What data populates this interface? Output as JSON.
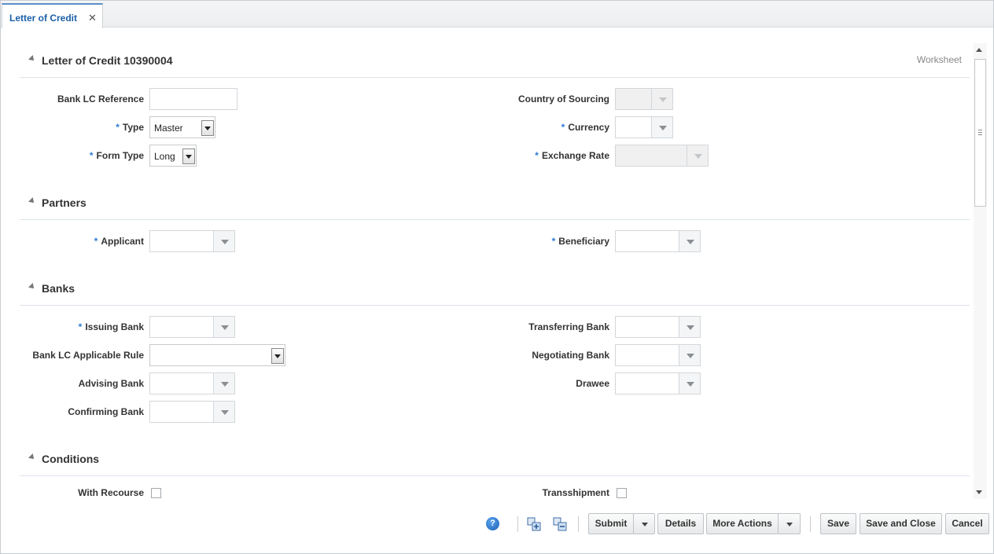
{
  "tab": {
    "label": "Letter of Credit",
    "close": "✕"
  },
  "header": {
    "title": "Letter of Credit 10390004",
    "status": "Worksheet"
  },
  "general": {
    "bank_lc_reference": {
      "label": "Bank LC Reference",
      "value": ""
    },
    "type": {
      "label": "Type",
      "value": "Master"
    },
    "form_type": {
      "label": "Form Type",
      "value": "Long"
    },
    "country_of_sourcing": {
      "label": "Country of Sourcing",
      "value": ""
    },
    "currency": {
      "label": "Currency",
      "value": ""
    },
    "exchange_rate": {
      "label": "Exchange Rate",
      "value": ""
    }
  },
  "partners": {
    "title": "Partners",
    "applicant": {
      "label": "Applicant",
      "value": ""
    },
    "beneficiary": {
      "label": "Beneficiary",
      "value": ""
    }
  },
  "banks": {
    "title": "Banks",
    "issuing_bank": {
      "label": "Issuing Bank",
      "value": ""
    },
    "bank_lc_applicable_rule": {
      "label": "Bank LC Applicable Rule",
      "value": ""
    },
    "advising_bank": {
      "label": "Advising Bank",
      "value": ""
    },
    "confirming_bank": {
      "label": "Confirming Bank",
      "value": ""
    },
    "transferring_bank": {
      "label": "Transferring Bank",
      "value": ""
    },
    "negotiating_bank": {
      "label": "Negotiating Bank",
      "value": ""
    },
    "drawee": {
      "label": "Drawee",
      "value": ""
    }
  },
  "conditions": {
    "title": "Conditions",
    "with_recourse": {
      "label": "With Recourse",
      "checked": false
    },
    "transshipment": {
      "label": "Transshipment",
      "checked": false
    }
  },
  "required_marker": "*",
  "toolbar": {
    "help": "?",
    "submit": "Submit",
    "details": "Details",
    "more_actions": "More Actions",
    "save": "Save",
    "save_and_close": "Save and Close",
    "cancel": "Cancel"
  }
}
